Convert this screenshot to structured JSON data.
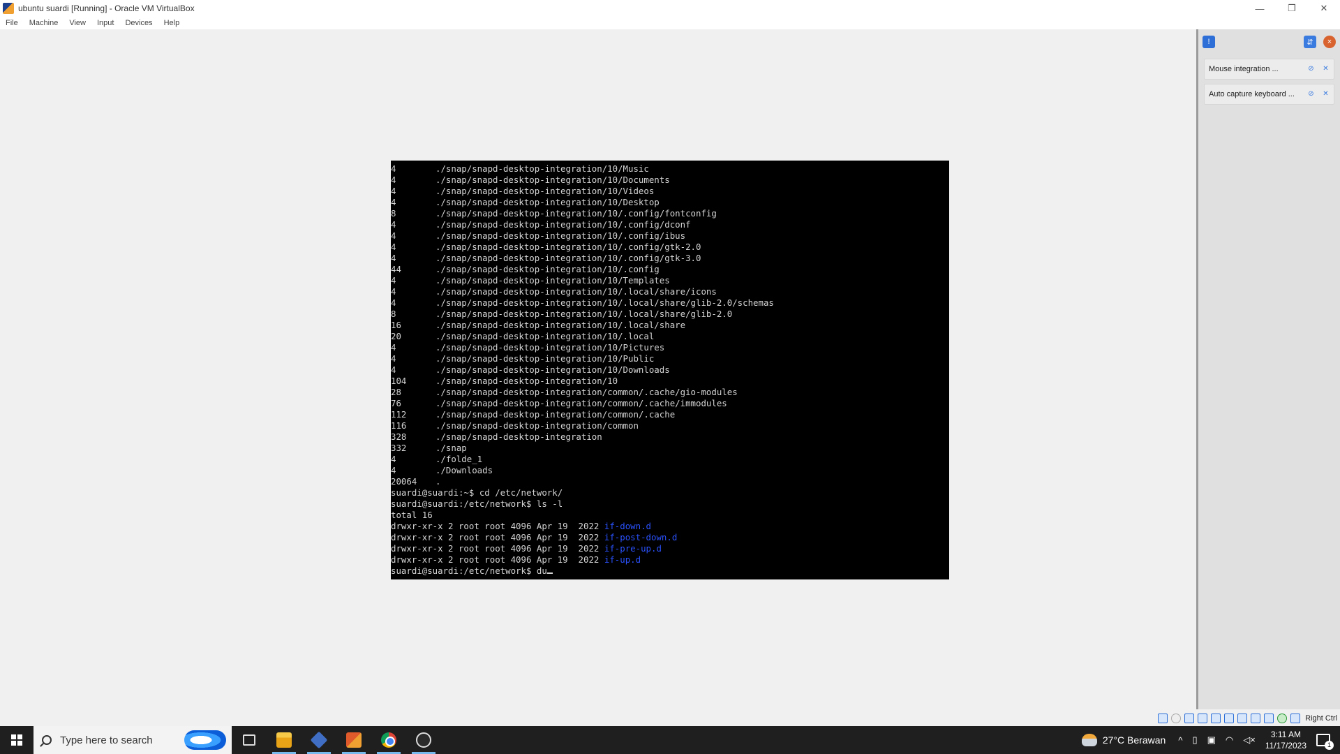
{
  "window": {
    "title": "ubuntu suardi [Running] - Oracle VM VirtualBox",
    "minimize_glyph": "—",
    "restore_glyph": "❐",
    "close_glyph": "✕"
  },
  "menu": {
    "items": [
      "File",
      "Machine",
      "View",
      "Input",
      "Devices",
      "Help"
    ]
  },
  "terminal": {
    "du_lines": [
      {
        "size": "4",
        "path": "./snap/snapd-desktop-integration/10/Music"
      },
      {
        "size": "4",
        "path": "./snap/snapd-desktop-integration/10/Documents"
      },
      {
        "size": "4",
        "path": "./snap/snapd-desktop-integration/10/Videos"
      },
      {
        "size": "4",
        "path": "./snap/snapd-desktop-integration/10/Desktop"
      },
      {
        "size": "8",
        "path": "./snap/snapd-desktop-integration/10/.config/fontconfig"
      },
      {
        "size": "4",
        "path": "./snap/snapd-desktop-integration/10/.config/dconf"
      },
      {
        "size": "4",
        "path": "./snap/snapd-desktop-integration/10/.config/ibus"
      },
      {
        "size": "4",
        "path": "./snap/snapd-desktop-integration/10/.config/gtk-2.0"
      },
      {
        "size": "4",
        "path": "./snap/snapd-desktop-integration/10/.config/gtk-3.0"
      },
      {
        "size": "44",
        "path": "./snap/snapd-desktop-integration/10/.config"
      },
      {
        "size": "4",
        "path": "./snap/snapd-desktop-integration/10/Templates"
      },
      {
        "size": "4",
        "path": "./snap/snapd-desktop-integration/10/.local/share/icons"
      },
      {
        "size": "4",
        "path": "./snap/snapd-desktop-integration/10/.local/share/glib-2.0/schemas"
      },
      {
        "size": "8",
        "path": "./snap/snapd-desktop-integration/10/.local/share/glib-2.0"
      },
      {
        "size": "16",
        "path": "./snap/snapd-desktop-integration/10/.local/share"
      },
      {
        "size": "20",
        "path": "./snap/snapd-desktop-integration/10/.local"
      },
      {
        "size": "4",
        "path": "./snap/snapd-desktop-integration/10/Pictures"
      },
      {
        "size": "4",
        "path": "./snap/snapd-desktop-integration/10/Public"
      },
      {
        "size": "4",
        "path": "./snap/snapd-desktop-integration/10/Downloads"
      },
      {
        "size": "104",
        "path": "./snap/snapd-desktop-integration/10"
      },
      {
        "size": "28",
        "path": "./snap/snapd-desktop-integration/common/.cache/gio-modules"
      },
      {
        "size": "76",
        "path": "./snap/snapd-desktop-integration/common/.cache/immodules"
      },
      {
        "size": "112",
        "path": "./snap/snapd-desktop-integration/common/.cache"
      },
      {
        "size": "116",
        "path": "./snap/snapd-desktop-integration/common"
      },
      {
        "size": "328",
        "path": "./snap/snapd-desktop-integration"
      },
      {
        "size": "332",
        "path": "./snap"
      },
      {
        "size": "4",
        "path": "./folde_1"
      },
      {
        "size": "4",
        "path": "./Downloads"
      },
      {
        "size": "20064",
        "path": "."
      }
    ],
    "cmd_cd": "suardi@suardi:~$ cd /etc/network/",
    "cmd_ls": "suardi@suardi:/etc/network$ ls -l",
    "ls_total": "total 16",
    "ls_entries": [
      {
        "meta": "drwxr-xr-x 2 root root 4096 Apr 19  2022 ",
        "name": "if-down.d"
      },
      {
        "meta": "drwxr-xr-x 2 root root 4096 Apr 19  2022 ",
        "name": "if-post-down.d"
      },
      {
        "meta": "drwxr-xr-x 2 root root 4096 Apr 19  2022 ",
        "name": "if-pre-up.d"
      },
      {
        "meta": "drwxr-xr-x 2 root root 4096 Apr 19  2022 ",
        "name": "if-up.d"
      }
    ],
    "prompt_current": "suardi@suardi:/etc/network$ du"
  },
  "notifications": {
    "items": [
      "Mouse integration ...",
      "Auto capture keyboard ..."
    ]
  },
  "statusbar": {
    "host_key": "Right Ctrl"
  },
  "taskbar": {
    "search_placeholder": "Type here to search",
    "weather": "27°C  Berawan",
    "time": "3:11 AM",
    "date": "11/17/2023",
    "notification_count": "1"
  },
  "colors": {
    "terminal_bg": "#000000",
    "terminal_fg": "#d4d4d4",
    "ls_dir": "#2a52ff",
    "taskbar_bg": "#1f1f1f"
  }
}
